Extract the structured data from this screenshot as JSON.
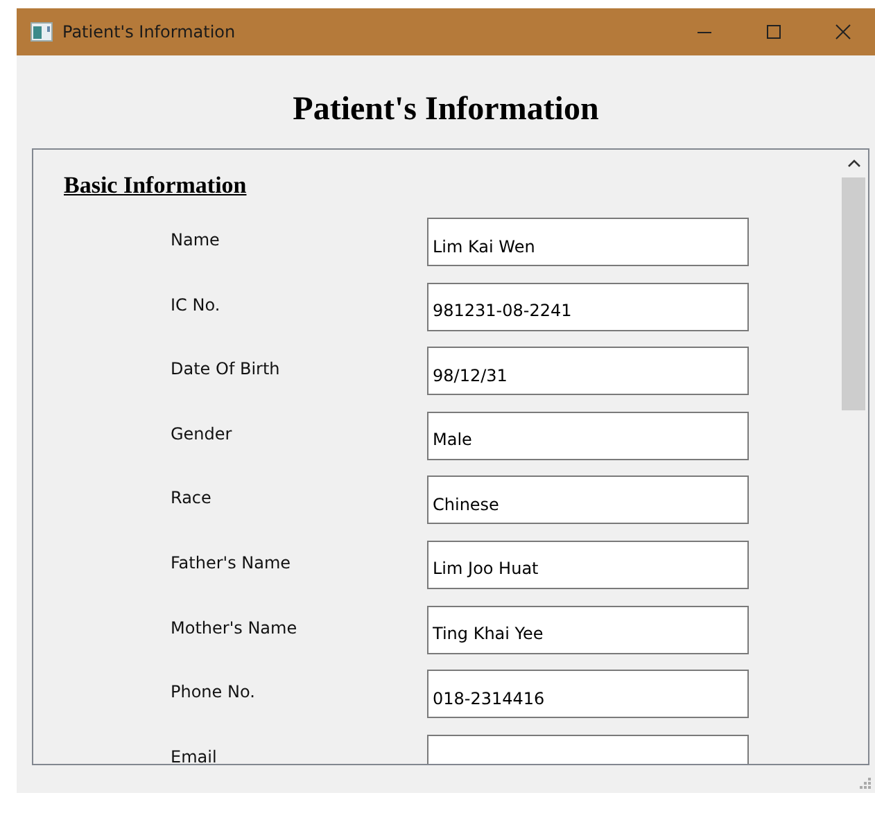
{
  "window": {
    "title": "Patient's Information"
  },
  "heading": "Patient's Information",
  "section": {
    "title": "Basic Information",
    "fields": [
      {
        "label": "Name",
        "value": "Lim Kai Wen"
      },
      {
        "label": "IC No.",
        "value": "981231-08-2241"
      },
      {
        "label": "Date Of Birth",
        "value": "98/12/31"
      },
      {
        "label": "Gender",
        "value": "Male"
      },
      {
        "label": "Race",
        "value": "Chinese"
      },
      {
        "label": "Father's Name",
        "value": "Lim Joo Huat"
      },
      {
        "label": "Mother's Name",
        "value": "Ting Khai Yee"
      },
      {
        "label": "Phone No.",
        "value": "018-2314416"
      },
      {
        "label": "Email"
      }
    ]
  }
}
